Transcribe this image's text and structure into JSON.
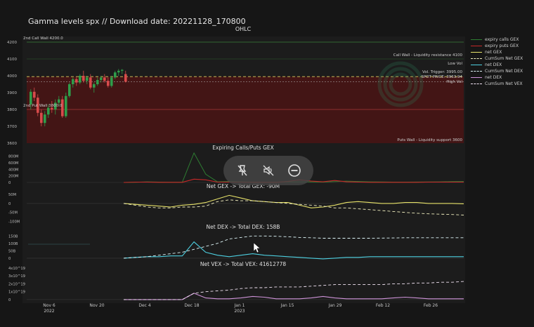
{
  "title": "Gamma levels spx //  Download date: 20221128_170800",
  "colors": {
    "calls": "#2e7d32",
    "puts": "#c62828",
    "net_gex": "#e8e36a",
    "cum_gex": "#f2f0c0",
    "net_dex": "#4dd0e1",
    "cum_dex": "#e0f7fa",
    "net_vex": "#ce93d8",
    "cum_vex": "#f3e5f5",
    "candle_up": "#2e9d4a",
    "candle_down": "#d84b4b"
  },
  "legend": [
    {
      "label": "expiry calls GEX",
      "color": "#2e7d32",
      "style": "solid"
    },
    {
      "label": "expiry puts GEX",
      "color": "#c62828",
      "style": "solid"
    },
    {
      "label": "net GEX",
      "color": "#e8e36a",
      "style": "solid"
    },
    {
      "label": "CumSum Net GEX",
      "color": "#f2f0c0",
      "style": "dash"
    },
    {
      "label": "net DEX",
      "color": "#4dd0e1",
      "style": "solid"
    },
    {
      "label": "CumSum Net DEX",
      "color": "#e0f7fa",
      "style": "dash"
    },
    {
      "label": "net DEX",
      "color": "#ce93d8",
      "style": "solid"
    },
    {
      "label": "CumSum Net VEX",
      "color": "#f3e5f5",
      "style": "dash"
    }
  ],
  "media_controls": {
    "icons": [
      "pin-off-icon",
      "mute-icon",
      "minus-circle-icon"
    ]
  },
  "chart_data": [
    {
      "type": "candlestick",
      "title": "OHLC",
      "ylim": [
        3600,
        4200
      ],
      "yticks": [
        "3600",
        "3700",
        "3800",
        "3900",
        "4000",
        "4100",
        "4200"
      ],
      "annotations": {
        "call_wall": "2nd Call Wall 4200.0",
        "put_wall": "2nd Put Wall 3800.0",
        "call_wall_right": "Call Wall - Liquidity resistance 4100",
        "low_vol": "Low Vol",
        "vol_trigger": "Vol. Trigger: 3995.00",
        "spot": "SPOT PRICE: 3963.94",
        "high_vol": "High Vol",
        "put_wall_right": "Puts Wall - Liquidity support 3600"
      },
      "levels": {
        "call_wall_2": 4200,
        "call_wall": 4100,
        "vol_trigger": 3995,
        "spot": 3964,
        "put_wall_2": 3800,
        "put_wall": 3600
      },
      "candles": [
        {
          "o": 3830,
          "h": 3920,
          "l": 3800,
          "c": 3905
        },
        {
          "o": 3905,
          "h": 3930,
          "l": 3850,
          "c": 3870
        },
        {
          "o": 3870,
          "h": 3890,
          "l": 3760,
          "c": 3780
        },
        {
          "o": 3780,
          "h": 3800,
          "l": 3700,
          "c": 3720
        },
        {
          "o": 3720,
          "h": 3790,
          "l": 3700,
          "c": 3770
        },
        {
          "o": 3770,
          "h": 3830,
          "l": 3750,
          "c": 3810
        },
        {
          "o": 3810,
          "h": 3850,
          "l": 3780,
          "c": 3800
        },
        {
          "o": 3800,
          "h": 3860,
          "l": 3770,
          "c": 3840
        },
        {
          "o": 3840,
          "h": 3880,
          "l": 3820,
          "c": 3860
        },
        {
          "o": 3860,
          "h": 3880,
          "l": 3750,
          "c": 3760
        },
        {
          "o": 3760,
          "h": 3900,
          "l": 3750,
          "c": 3880
        },
        {
          "o": 3880,
          "h": 3960,
          "l": 3870,
          "c": 3950
        },
        {
          "o": 3950,
          "h": 3990,
          "l": 3930,
          "c": 3980
        },
        {
          "o": 3980,
          "h": 3990,
          "l": 3940,
          "c": 3960
        },
        {
          "o": 3960,
          "h": 4010,
          "l": 3950,
          "c": 4000
        },
        {
          "o": 4000,
          "h": 4030,
          "l": 3960,
          "c": 3970
        },
        {
          "o": 3970,
          "h": 4000,
          "l": 3950,
          "c": 3990
        },
        {
          "o": 3990,
          "h": 4010,
          "l": 3920,
          "c": 3930
        },
        {
          "o": 3930,
          "h": 3960,
          "l": 3900,
          "c": 3950
        },
        {
          "o": 3950,
          "h": 3990,
          "l": 3940,
          "c": 3975
        },
        {
          "o": 3975,
          "h": 4000,
          "l": 3960,
          "c": 3990
        },
        {
          "o": 3990,
          "h": 4010,
          "l": 3960,
          "c": 3970
        },
        {
          "o": 3970,
          "h": 3990,
          "l": 3930,
          "c": 3940
        },
        {
          "o": 3940,
          "h": 4000,
          "l": 3930,
          "c": 3990
        },
        {
          "o": 3990,
          "h": 4030,
          "l": 3980,
          "c": 4020
        },
        {
          "o": 4020,
          "h": 4040,
          "l": 4000,
          "c": 4030
        },
        {
          "o": 4030,
          "h": 4040,
          "l": 4010,
          "c": 4035
        },
        {
          "o": 4010,
          "h": 4030,
          "l": 3960,
          "c": 3965
        }
      ]
    },
    {
      "type": "line",
      "title": "Expiring Calls/Puts GEX",
      "yticks": [
        "0",
        "200M",
        "400M",
        "600M",
        "800M"
      ],
      "ylim": [
        0,
        900
      ],
      "series": [
        {
          "name": "expiry calls GEX",
          "values": [
            0,
            5,
            20,
            10,
            5,
            5,
            900,
            250,
            20,
            30,
            20,
            10,
            5,
            10,
            15,
            20,
            15,
            10,
            25,
            40,
            30,
            20,
            15,
            10,
            10,
            12,
            15,
            20,
            25,
            30
          ]
        },
        {
          "name": "expiry puts GEX",
          "values": [
            0,
            10,
            10,
            5,
            5,
            5,
            100,
            80,
            10,
            10,
            10,
            5,
            5,
            5,
            30,
            80,
            40,
            20,
            60,
            20,
            10,
            5,
            5,
            5,
            5,
            5,
            10,
            10,
            10,
            10
          ]
        }
      ]
    },
    {
      "type": "line",
      "title": "Net GEX -> Total GEX: -90M",
      "yticks": [
        "-100M",
        "-50M",
        "0",
        "50M"
      ],
      "ylim": [
        -110,
        70
      ],
      "series": [
        {
          "name": "net GEX",
          "values": [
            0,
            -5,
            -10,
            -15,
            -20,
            -10,
            -5,
            5,
            25,
            45,
            30,
            15,
            10,
            5,
            5,
            -10,
            -25,
            -20,
            -10,
            5,
            10,
            5,
            0,
            0,
            5,
            5,
            0,
            0,
            0,
            -2
          ]
        },
        {
          "name": "CumSum Net GEX",
          "values": [
            0,
            -10,
            -20,
            -25,
            -25,
            -20,
            -20,
            -15,
            10,
            20,
            15,
            15,
            10,
            5,
            0,
            -5,
            -10,
            -15,
            -25,
            -25,
            -30,
            -35,
            -40,
            -45,
            -50,
            -55,
            -58,
            -60,
            -62,
            -65
          ]
        }
      ]
    },
    {
      "type": "line",
      "title": "Net DEX -> Total DEX: 158B",
      "yticks": [
        "0",
        "50B",
        "100B",
        "150B"
      ],
      "ylim": [
        -10,
        180
      ],
      "series": [
        {
          "name": "net DEX",
          "values": [
            0,
            5,
            10,
            10,
            15,
            15,
            110,
            40,
            20,
            10,
            20,
            30,
            20,
            15,
            10,
            5,
            0,
            -5,
            0,
            5,
            5,
            10,
            10,
            10,
            10,
            10,
            10,
            10,
            10,
            10
          ]
        },
        {
          "name": "CumSum Net DEX",
          "values": [
            0,
            5,
            10,
            20,
            30,
            40,
            60,
            80,
            100,
            130,
            140,
            150,
            150,
            148,
            145,
            140,
            138,
            135,
            135,
            135,
            135,
            135,
            136,
            137,
            138,
            138,
            138,
            138,
            138,
            138
          ]
        }
      ]
    },
    {
      "type": "line",
      "title": "Net VEX -> Total VEX: 41612778",
      "yticks": [
        "0",
        "1x10^19",
        "2x10^19",
        "3x10^19",
        "4x10^19"
      ],
      "ylim": [
        -1,
        40
      ],
      "series": [
        {
          "name": "net VEX",
          "values": [
            0,
            0,
            0,
            0,
            0,
            0,
            8,
            2,
            1,
            1,
            2,
            4,
            3,
            1,
            1,
            1,
            2,
            4,
            2,
            1,
            1,
            1,
            1,
            2,
            3,
            2,
            1,
            1,
            1,
            1
          ]
        },
        {
          "name": "CumSum Net VEX",
          "values": [
            0,
            0,
            0,
            0,
            0,
            0,
            8,
            10,
            11,
            12,
            14,
            15,
            15,
            16,
            16,
            16,
            17,
            18,
            19,
            19,
            19,
            19,
            19,
            20,
            20,
            21,
            21,
            22,
            22,
            23
          ]
        }
      ]
    }
  ],
  "xaxis": {
    "ticks": [
      {
        "label": "Nov 6",
        "sub": "2022"
      },
      {
        "label": "Nov 20",
        "sub": ""
      },
      {
        "label": "Dec 4",
        "sub": ""
      },
      {
        "label": "Dec 18",
        "sub": ""
      },
      {
        "label": "Jan 1",
        "sub": "2023"
      },
      {
        "label": "Jan 15",
        "sub": ""
      },
      {
        "label": "Jan 29",
        "sub": ""
      },
      {
        "label": "Feb 12",
        "sub": ""
      },
      {
        "label": "Feb 26",
        "sub": ""
      }
    ]
  }
}
